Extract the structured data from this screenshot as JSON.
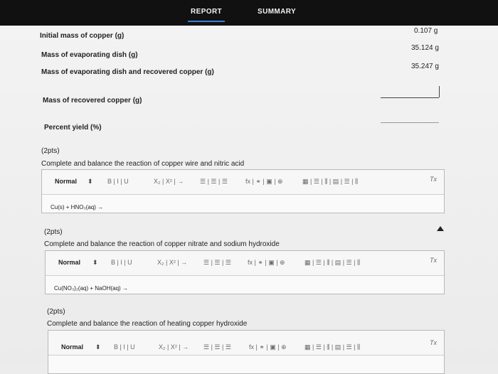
{
  "tabs": [
    {
      "label": "REPORT"
    },
    {
      "label": "SUMMARY"
    }
  ],
  "results": {
    "initial_mass_label": "Initial mass of copper (g)",
    "initial_mass_value": "0.107 g",
    "dish_mass_label": "Mass of evaporating dish (g)",
    "dish_mass_value": "35.124 g",
    "dish_plus_copper_label": "Mass of evaporating dish and recovered copper (g)",
    "dish_plus_copper_value": "35.247 g",
    "recovered_copper_label": "Mass of recovered copper (g)",
    "recovered_copper_value": "",
    "percent_yield_label": "Percent yield (%)",
    "percent_yield_value": ""
  },
  "questions": [
    {
      "points": "(2pts)",
      "prompt": "Complete and balance the reaction of copper wire and nitric acid",
      "answer": "Cu(s) + HNO₃(aq) →"
    },
    {
      "points": "(2pts)",
      "prompt": "Complete and balance the reaction of copper nitrate and sodium hydroxide",
      "answer": "Cu(NO₃)₂(aq) + NaOH(aq) →"
    },
    {
      "points": "(2pts)",
      "prompt": "Complete and balance the reaction of heating copper hydroxide",
      "answer": ""
    }
  ],
  "toolbar": {
    "format": "Normal",
    "stepper": "⬍",
    "groups": [
      "B | I | U",
      "X₂ | X² | →",
      "☰ | ☰ | ☰",
      "fx | ⚭ | ▣ | ⊕",
      "▦ | ☰ | ⫼ | ▤ | ☰ | ⫼"
    ],
    "clear": "Tx"
  }
}
